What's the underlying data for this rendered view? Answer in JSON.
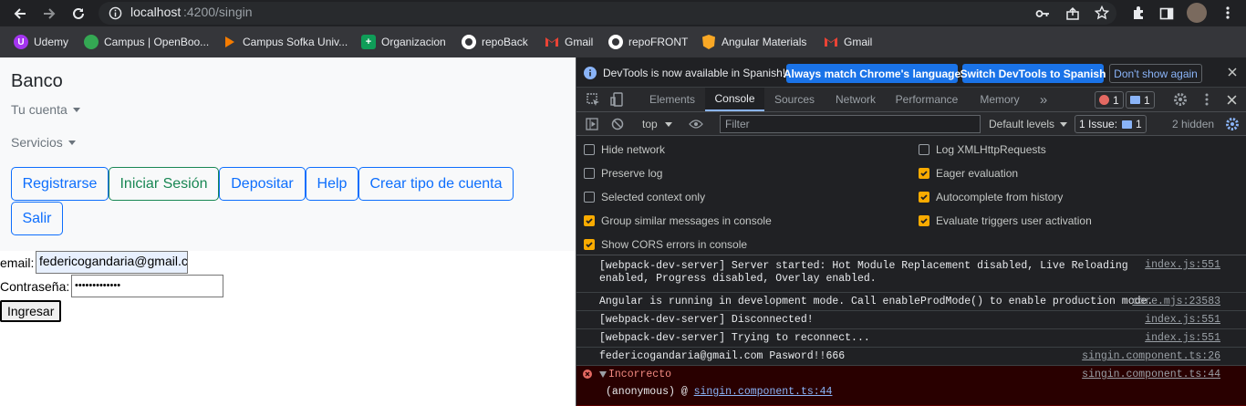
{
  "browser": {
    "url_host": "localhost",
    "url_path": ":4200/singin",
    "bookmarks": [
      {
        "label": "Udemy",
        "color": "#a435f0"
      },
      {
        "label": "Campus | OpenBoo...",
        "color": "#34a853"
      },
      {
        "label": "Campus Sofka Univ...",
        "color": "#f57c00"
      },
      {
        "label": "Organizacion",
        "color": "#0f9d58"
      },
      {
        "label": "repoBack",
        "color": "#ffffff"
      },
      {
        "label": "Gmail",
        "color": "#ea4335"
      },
      {
        "label": "repoFRONT",
        "color": "#ffffff"
      },
      {
        "label": "Angular Materials",
        "color": "#f9a825"
      },
      {
        "label": "Gmail",
        "color": "#ea4335"
      }
    ]
  },
  "app": {
    "brand": "Banco",
    "menu_account": "Tu cuenta",
    "menu_services": "Servicios",
    "buttons": {
      "register": "Registrarse",
      "login": "Iniciar Sesión",
      "deposit": "Depositar",
      "help": "Help",
      "create_account_type": "Crear tipo de cuenta",
      "logout": "Salir"
    },
    "form": {
      "email_label": "email:",
      "email_value": "federicogandaria@gmail.com",
      "password_label": "Contraseña:",
      "password_value": "•••••••••••••",
      "submit": "Ingresar"
    }
  },
  "devtools": {
    "infobar": {
      "message": "DevTools is now available in Spanish!",
      "btn_match": "Always match Chrome's language",
      "btn_switch": "Switch DevTools to Spanish",
      "btn_dismiss": "Don't show again"
    },
    "tabs": [
      "Elements",
      "Console",
      "Sources",
      "Network",
      "Performance",
      "Memory"
    ],
    "active_tab": "Console",
    "more_tabs": "»",
    "error_count": "1",
    "message_count": "1",
    "toolbar": {
      "context": "top",
      "filter_placeholder": "Filter",
      "levels": "Default levels",
      "issues_label": "1 Issue:",
      "issues_count": "1",
      "hidden": "2 hidden"
    },
    "settings_left": [
      {
        "label": "Hide network",
        "checked": false
      },
      {
        "label": "Preserve log",
        "checked": false
      },
      {
        "label": "Selected context only",
        "checked": false
      },
      {
        "label": "Group similar messages in console",
        "checked": true
      },
      {
        "label": "Show CORS errors in console",
        "checked": true
      }
    ],
    "settings_right": [
      {
        "label": "Log XMLHttpRequests",
        "checked": false
      },
      {
        "label": "Eager evaluation",
        "checked": true
      },
      {
        "label": "Autocomplete from history",
        "checked": true
      },
      {
        "label": "Evaluate triggers user activation",
        "checked": true
      }
    ],
    "messages": [
      {
        "text": "[webpack-dev-server] Server started: Hot Module Replacement disabled, Live Reloading\nenabled, Progress disabled, Overlay enabled.",
        "source": "index.js:551"
      },
      {
        "text": "Angular is running in development mode. Call enableProdMode() to enable production mode.",
        "source": "core.mjs:23583"
      },
      {
        "text": "[webpack-dev-server] Disconnected!",
        "source": "index.js:551"
      },
      {
        "text": "[webpack-dev-server] Trying to reconnect...",
        "source": "index.js:551"
      },
      {
        "text": "federicogandaria@gmail.com Pasword!!666",
        "source": "singin.component.ts:26"
      }
    ],
    "error": {
      "title": "Incorrecto",
      "source": "singin.component.ts:44",
      "trace_prefix": "(anonymous) @ ",
      "trace_link": "singin.component.ts:44"
    },
    "colors": {
      "accent": "#8ab4f8",
      "error": "#f28b82",
      "checkbox": "#f9ab00"
    }
  }
}
